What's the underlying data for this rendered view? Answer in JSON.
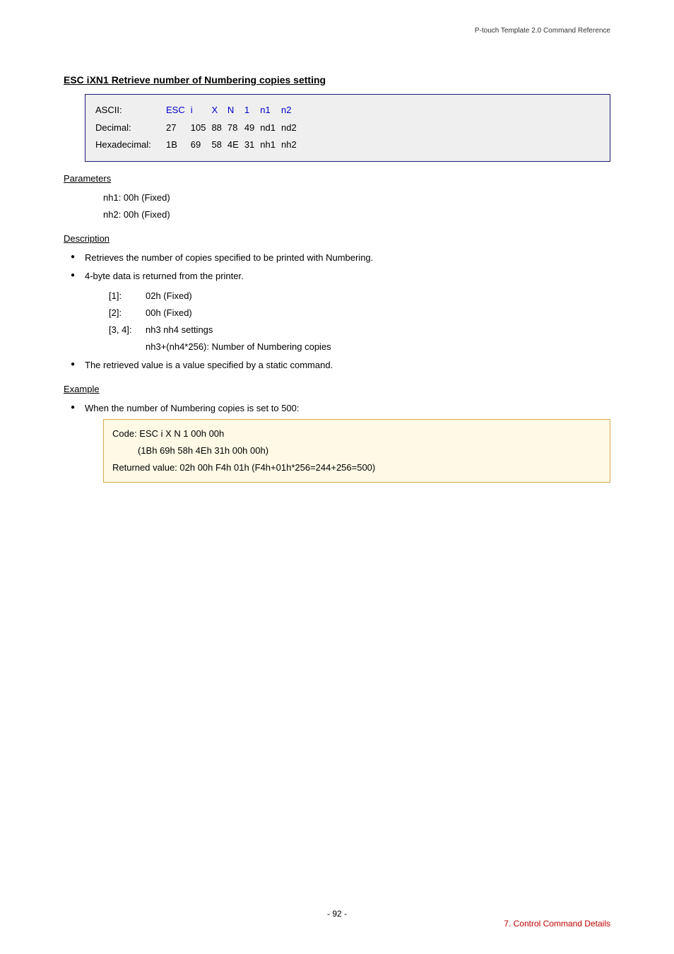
{
  "header": {
    "doc_title": "P-touch Template 2.0 Command Reference"
  },
  "section": {
    "heading": "ESC iXN1   Retrieve number of Numbering copies setting"
  },
  "code_table": {
    "rows": [
      {
        "label": "ASCII:",
        "c1": "ESC",
        "c2": "i",
        "c3": "X",
        "c4": "N",
        "c5": "1",
        "c6": "n1",
        "c7": "n2",
        "blue": true
      },
      {
        "label": "Decimal:",
        "c1": "27",
        "c2": "105",
        "c3": "88",
        "c4": "78",
        "c5": "49",
        "c6": "nd1",
        "c7": "nd2",
        "blue": false
      },
      {
        "label": "Hexadecimal:",
        "c1": "1B",
        "c2": "69",
        "c3": "58",
        "c4": "4E",
        "c5": "31",
        "c6": "nh1",
        "c7": "nh2",
        "blue": false
      }
    ]
  },
  "parameters": {
    "heading": "Parameters",
    "lines": [
      "nh1: 00h (Fixed)",
      "nh2: 00h (Fixed)"
    ]
  },
  "description": {
    "heading": "Description",
    "bullets": [
      {
        "text": "Retrieves the number of copies specified to be printed with Numbering."
      },
      {
        "text": "4-byte data is returned from the printer.",
        "defs": [
          {
            "key": "[1]:",
            "val": "02h (Fixed)"
          },
          {
            "key": "[2]:",
            "val": "00h (Fixed)"
          },
          {
            "key": "[3, 4]:",
            "val": "nh3 nh4 settings",
            "sub": "nh3+(nh4*256): Number of Numbering copies"
          }
        ]
      },
      {
        "text": "The retrieved value is a value specified by a static command."
      }
    ]
  },
  "example": {
    "heading": "Example",
    "bullet": "When the number of Numbering copies is set to 500:",
    "box": {
      "line1": "Code: ESC i X N 1 00h 00h",
      "line2": "(1Bh 69h 58h 4Eh 31h 00h 00h)",
      "line3": "Returned value: 02h 00h F4h 01h (F4h+01h*256=244+256=500)"
    }
  },
  "footer": {
    "page": "- 92 -",
    "section": "7. Control Command Details"
  }
}
